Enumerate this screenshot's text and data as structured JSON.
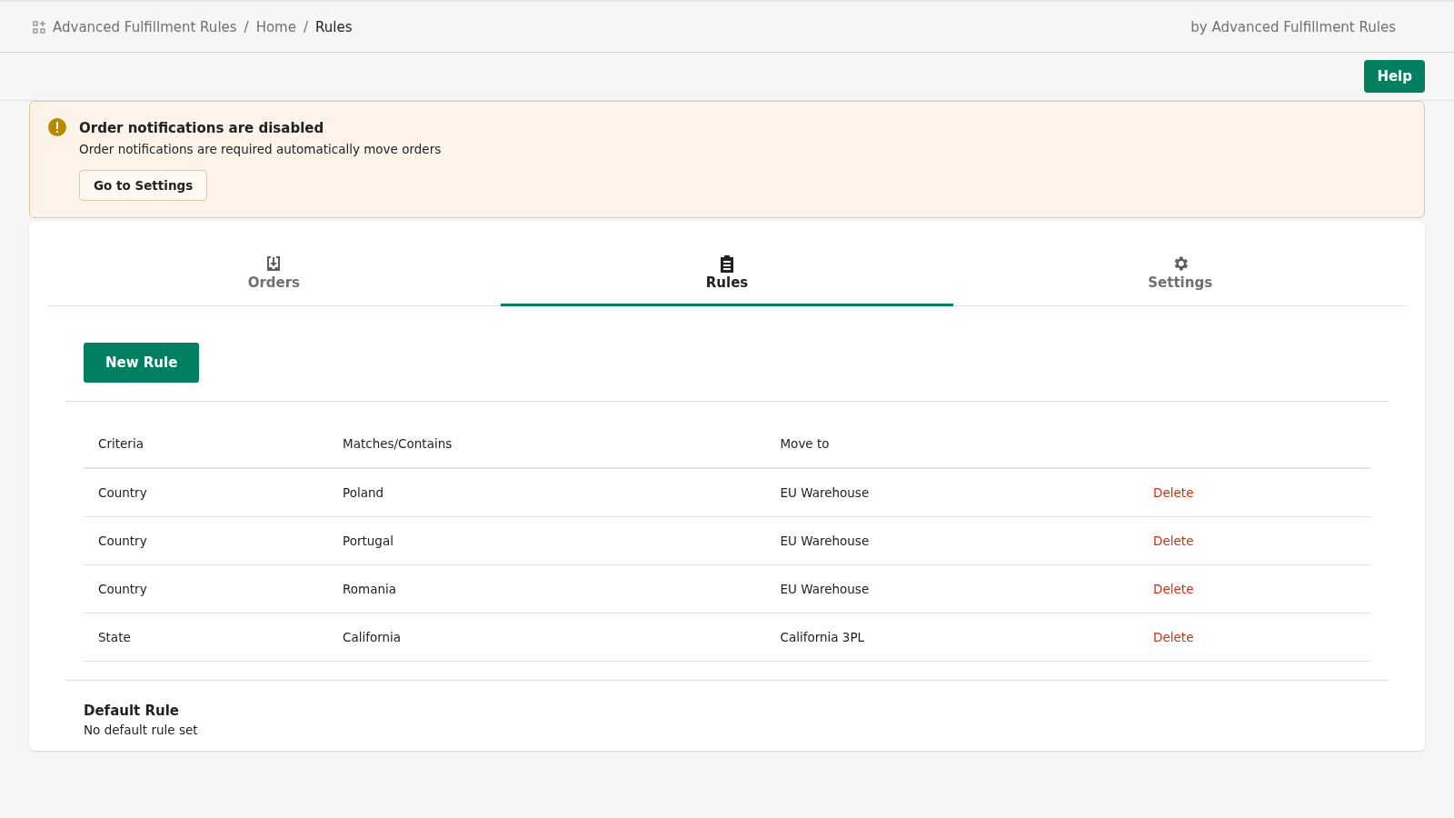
{
  "breadcrumb": [
    {
      "label": "Advanced Fulfillment Rules",
      "current": false
    },
    {
      "label": "Home",
      "current": false
    },
    {
      "label": "Rules",
      "current": true
    }
  ],
  "breadcrumb_separator": "/",
  "developer": "by Advanced Fulfillment Rules",
  "help_button": "Help",
  "banner": {
    "title": "Order notifications are disabled",
    "message": "Order notifications are required automatically move orders",
    "button": "Go to Settings"
  },
  "tabs": [
    {
      "label": "Orders",
      "kind": "download",
      "selected": false
    },
    {
      "label": "Rules",
      "kind": "clipboard",
      "selected": true
    },
    {
      "label": "Settings",
      "kind": "gear",
      "selected": false
    }
  ],
  "new_rule_button": "New Rule",
  "table": {
    "columns": [
      "Criteria",
      "Matches/Contains",
      "Move to"
    ],
    "rows": [
      {
        "criteria": "Country",
        "value": "Poland",
        "move_to": "EU Warehouse",
        "action": "Delete"
      },
      {
        "criteria": "Country",
        "value": "Portugal",
        "move_to": "EU Warehouse",
        "action": "Delete"
      },
      {
        "criteria": "Country",
        "value": "Romania",
        "move_to": "EU Warehouse",
        "action": "Delete"
      },
      {
        "criteria": "State",
        "value": "California",
        "move_to": "California 3PL",
        "action": "Delete"
      }
    ]
  },
  "default_rule": {
    "title": "Default Rule",
    "text": "No default rule set"
  }
}
